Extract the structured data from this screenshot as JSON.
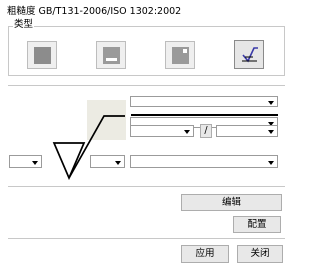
{
  "window": {
    "title": "粗糙度 GB/T131-2006/ISO 1302:2002"
  },
  "type_group": {
    "label": "类型",
    "selected_index": 3
  },
  "separator_label": "/",
  "buttons": {
    "edit": "编辑",
    "config": "配置",
    "apply": "应用",
    "close": "关闭"
  },
  "colors": {
    "button_bg": "#e8e8e8",
    "border": "#adadad",
    "accent": "#4a4ab0"
  }
}
